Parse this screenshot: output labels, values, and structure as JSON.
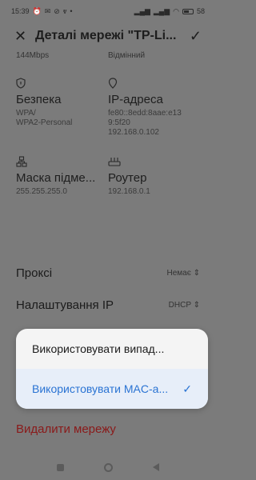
{
  "status": {
    "time": "15:39",
    "battery": "58"
  },
  "header": {
    "title": "Деталі мережі \"TP-Li..."
  },
  "speed": {
    "value": "144Mbps",
    "quality": "Відмінний"
  },
  "info": {
    "security_label": "Безпека",
    "security_value": "WPA/\nWPA2-Personal",
    "ip_label": "IP-адреса",
    "ip_value": "fe80::8edd:8aae:e13\n9:5f20\n192.168.0.102",
    "mask_label": "Маска підме...",
    "mask_value": "255.255.255.0",
    "router_label": "Роутер",
    "router_value": "192.168.0.1"
  },
  "settings": {
    "proxy_label": "Проксі",
    "proxy_value": "Немає",
    "ip_settings_label": "Налаштування IP",
    "ip_settings_value": "DHCP"
  },
  "delete_label": "Видалити мережу",
  "popup": {
    "option1": "Використовувати випад...",
    "option2": "Використовувати MAC-а..."
  },
  "colors": {
    "accent": "#2a73d3",
    "delete": "#8a1a1a"
  }
}
